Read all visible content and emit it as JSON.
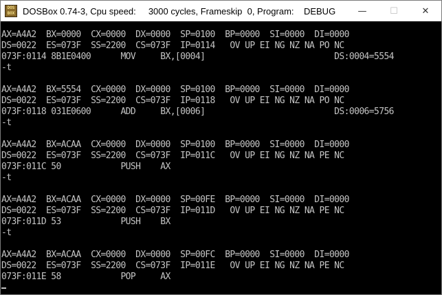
{
  "window": {
    "title": "DOSBox 0.74-3, Cpu speed:     3000 cycles, Frameskip  0, Program:    DEBUG",
    "icon": "dosbox-icon",
    "icon_text": [
      "DOS",
      "BOX"
    ],
    "controls": {
      "minimize": "—",
      "maximize": "☐",
      "close": "✕"
    }
  },
  "console": {
    "lines": [
      "AX=A4A2  BX=0000  CX=0000  DX=0000  SP=0100  BP=0000  SI=0000  DI=0000",
      "DS=0022  ES=073F  SS=2200  CS=073F  IP=0114   OV UP EI NG NZ NA PO NC",
      "073F:0114 8B1E0400      MOV     BX,[0004]                          DS:0004=5554",
      "-t",
      "",
      "AX=A4A2  BX=5554  CX=0000  DX=0000  SP=0100  BP=0000  SI=0000  DI=0000",
      "DS=0022  ES=073F  SS=2200  CS=073F  IP=0118   OV UP EI NG NZ NA PO NC",
      "073F:0118 031E0600      ADD     BX,[0006]                          DS:0006=5756",
      "-t",
      "",
      "AX=A4A2  BX=ACAA  CX=0000  DX=0000  SP=0100  BP=0000  SI=0000  DI=0000",
      "DS=0022  ES=073F  SS=2200  CS=073F  IP=011C   OV UP EI NG NZ NA PE NC",
      "073F:011C 50            PUSH    AX",
      "-t",
      "",
      "AX=A4A2  BX=ACAA  CX=0000  DX=0000  SP=00FE  BP=0000  SI=0000  DI=0000",
      "DS=0022  ES=073F  SS=2200  CS=073F  IP=011D   OV UP EI NG NZ NA PE NC",
      "073F:011D 53            PUSH    BX",
      "-t",
      "",
      "AX=A4A2  BX=ACAA  CX=0000  DX=0000  SP=00FC  BP=0000  SI=0000  DI=0000",
      "DS=0022  ES=073F  SS=2200  CS=073F  IP=011E   OV UP EI NG NZ NA PE NC",
      "073F:011E 58            POP     AX"
    ]
  }
}
